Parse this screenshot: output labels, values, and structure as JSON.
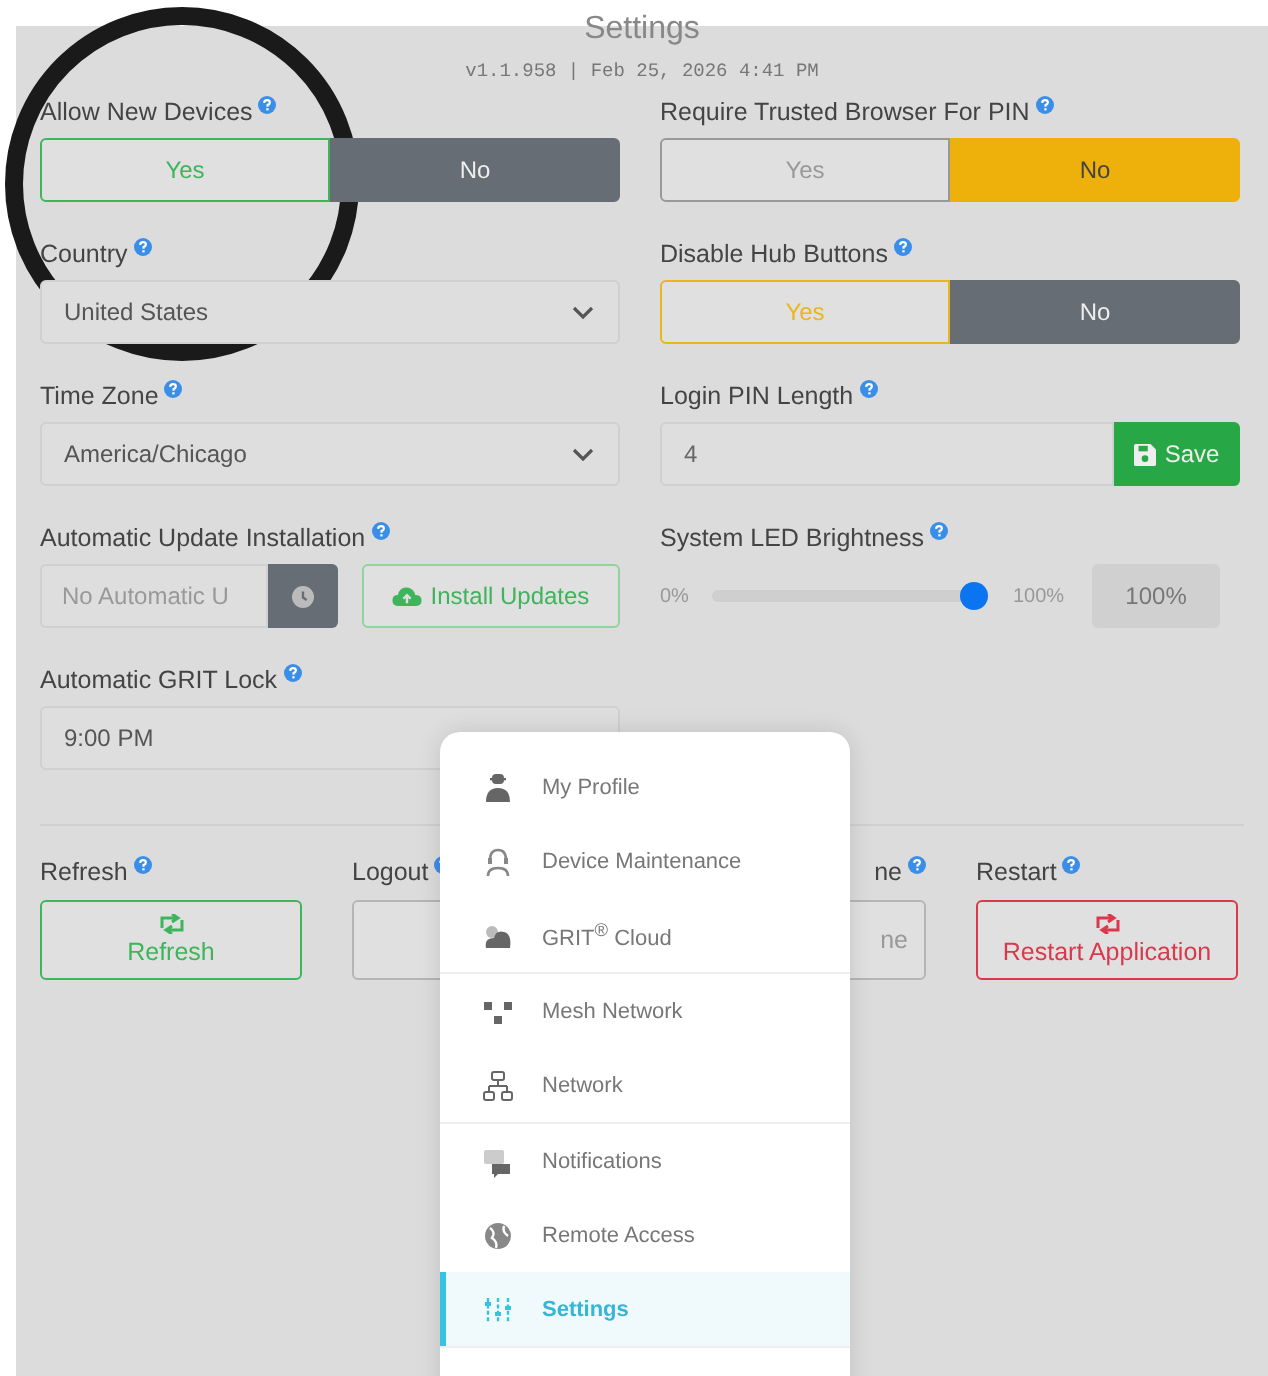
{
  "title": "Settings",
  "version": "v1.1.958 | Feb 25, 2026 4:41 PM",
  "rows": [
    {
      "left": {
        "kind": "toggle",
        "label": "Allow New Devices",
        "options": [
          {
            "label": "Yes",
            "selected": false,
            "color": "#3eb55a"
          },
          {
            "label": "No",
            "selected": true,
            "color": "#676d74"
          }
        ]
      },
      "right": {
        "kind": "toggle",
        "label": "Require Trusted Browser For PIN",
        "options": [
          {
            "label": "Yes",
            "selected": false,
            "color": "#999999"
          },
          {
            "label": "No",
            "selected": true,
            "color": "#eeb00a"
          }
        ]
      }
    },
    {
      "left": {
        "kind": "select",
        "label": "Country",
        "value": "United States"
      },
      "right": {
        "kind": "toggle",
        "label": "Disable Hub Buttons",
        "options": [
          {
            "label": "Yes",
            "selected": false,
            "color": "#e9b71a"
          },
          {
            "label": "No",
            "selected": true,
            "color": "#676d74"
          }
        ]
      }
    },
    {
      "left": {
        "kind": "select",
        "label": "Time Zone",
        "value": "America/Chicago"
      },
      "right": {
        "kind": "input_save",
        "label": "Login PIN Length",
        "value": "4",
        "button": "Save"
      }
    },
    {
      "left": {
        "kind": "update",
        "label": "Automatic Update Installation",
        "placeholder": "No Automatic U",
        "button": "Install Updates"
      },
      "right": {
        "kind": "slider",
        "label": "System LED Brightness",
        "min_label": "0%",
        "max_label": "100%",
        "level": 1.0,
        "reading": "100%"
      }
    },
    {
      "left": {
        "kind": "field",
        "label": "Automatic GRIT Lock",
        "value": "9:00 PM"
      }
    }
  ],
  "actions": [
    {
      "kind": "full",
      "label": "Refresh",
      "button": "Refresh",
      "color": "#3eb55a"
    },
    {
      "kind": "full",
      "label": "Logout",
      "color": "#b5b5b5"
    },
    {
      "kind": "covered",
      "label": "ne",
      "button": "ne",
      "color": "#b5b5b5"
    },
    {
      "kind": "full",
      "label": "Restart",
      "button": "Restart Application",
      "color": "#d9394a"
    }
  ],
  "menu": [
    [
      {
        "label": "My Profile",
        "selected": false
      },
      {
        "label": "Device Maintenance",
        "selected": false
      },
      {
        "label": "GRIT$^{®}$ Cloud",
        "selected": false
      }
    ],
    [
      {
        "label": "Mesh Network",
        "selected": false
      },
      {
        "label": "Network",
        "selected": false
      }
    ],
    [
      {
        "label": "Notifications",
        "selected": false
      },
      {
        "label": "Remote Access",
        "selected": false
      },
      {
        "label": "Settings",
        "selected": true
      }
    ]
  ]
}
